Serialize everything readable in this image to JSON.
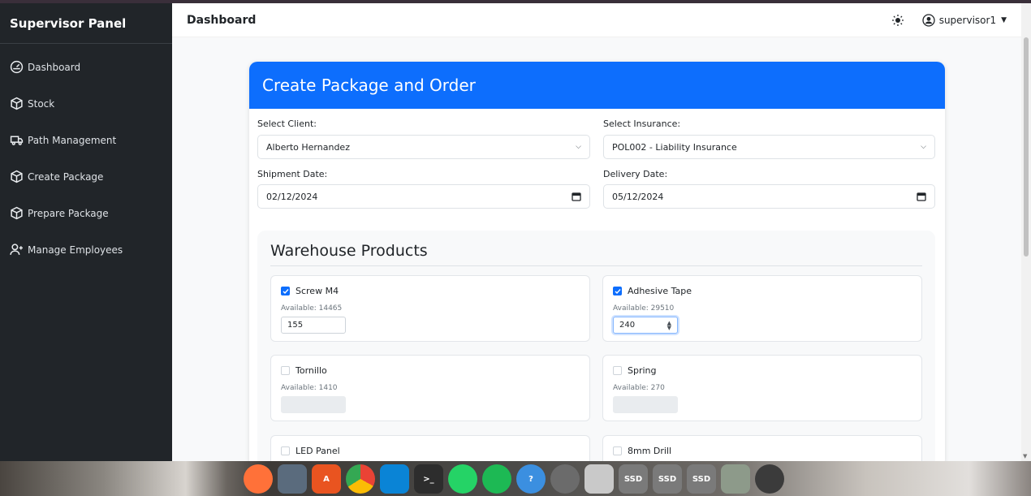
{
  "sidebar": {
    "brand": "Supervisor Panel",
    "items": [
      {
        "label": "Dashboard",
        "icon": "dashboard-gauge-icon"
      },
      {
        "label": "Stock",
        "icon": "box-icon"
      },
      {
        "label": "Path Management",
        "icon": "truck-icon"
      },
      {
        "label": "Create Package",
        "icon": "box-icon"
      },
      {
        "label": "Prepare Package",
        "icon": "box-icon"
      },
      {
        "label": "Manage Employees",
        "icon": "person-add-icon"
      }
    ]
  },
  "topbar": {
    "title": "Dashboard",
    "username": "supervisor1"
  },
  "form": {
    "header": "Create Package and Order",
    "client_label": "Select Client:",
    "client_value": "Alberto Hernandez",
    "insurance_label": "Select Insurance:",
    "insurance_value": "POL002 - Liability Insurance",
    "shipment_label": "Shipment Date:",
    "shipment_value": "02/12/2024",
    "delivery_label": "Delivery Date:",
    "delivery_value": "05/12/2024"
  },
  "warehouse": {
    "title": "Warehouse Products",
    "products": [
      {
        "name": "Screw M4",
        "available": "Available: 14465",
        "checked": true,
        "quantity": "155"
      },
      {
        "name": "Adhesive Tape",
        "available": "Available: 29510",
        "checked": true,
        "quantity": "240"
      },
      {
        "name": "Tornillo",
        "available": "Available: 1410",
        "checked": false,
        "quantity": ""
      },
      {
        "name": "Spring",
        "available": "Available: 270",
        "checked": false,
        "quantity": ""
      },
      {
        "name": "LED Panel",
        "available": "",
        "checked": false,
        "quantity": ""
      },
      {
        "name": "8mm Drill",
        "available": "",
        "checked": false,
        "quantity": ""
      }
    ]
  },
  "colors": {
    "primary": "#0d6efd",
    "sidebar_bg": "#212529"
  },
  "dock": {
    "apps": [
      "firefox-icon",
      "files-icon",
      "software-store-icon",
      "chrome-icon",
      "vscode-icon",
      "terminal-icon",
      "whatsapp-icon",
      "spotify-icon",
      "help-icon",
      "settings-icon",
      "screenshot-icon",
      "ssd-drive-icon",
      "ssd-drive-icon",
      "ssd-drive-icon",
      "trash-icon",
      "ubuntu-apps-icon"
    ],
    "ssd_label": "SSD"
  }
}
